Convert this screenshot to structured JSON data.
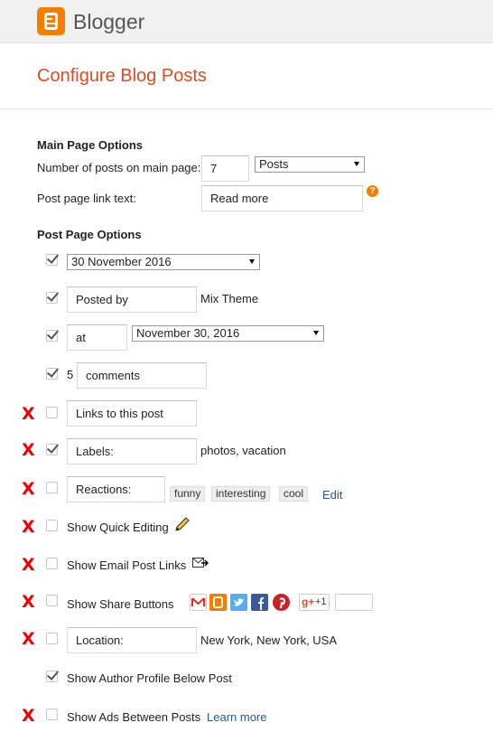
{
  "header": {
    "brand": "Blogger"
  },
  "page": {
    "title": "Configure Blog Posts"
  },
  "main_page_options": {
    "heading": "Main Page Options",
    "num_posts_label": "Number of posts on main page:",
    "num_posts_value": "7",
    "num_posts_unit": "Posts",
    "post_link_label": "Post page link text:",
    "post_link_value": "Read more",
    "help_glyph": "?"
  },
  "post_page_options": {
    "heading": "Post Page Options",
    "date_header": {
      "checked": true,
      "value": "30 November 2016"
    },
    "posted_by": {
      "checked": true,
      "value": "Posted by",
      "author": "Mix Theme"
    },
    "timestamp": {
      "checked": true,
      "value": "at",
      "format": "November 30, 2016"
    },
    "comments": {
      "checked": true,
      "count": "5",
      "value": "comments"
    },
    "links_to_post": {
      "checked": false,
      "value": "Links to this post"
    },
    "labels": {
      "checked": true,
      "value": "Labels:",
      "sample": "photos, vacation"
    },
    "reactions": {
      "checked": false,
      "value": "Reactions:",
      "tags": [
        "funny",
        "interesting",
        "cool"
      ],
      "edit_link": "Edit"
    },
    "quick_editing": {
      "checked": false,
      "label": "Show Quick Editing"
    },
    "email_links": {
      "checked": false,
      "label": "Show Email Post Links"
    },
    "share_buttons": {
      "checked": false,
      "label": "Show Share Buttons",
      "plus_one": "+1"
    },
    "location": {
      "checked": false,
      "value": "Location:",
      "sample": "New York, New York, USA"
    },
    "author_profile": {
      "checked": true,
      "label": "Show Author Profile Below Post"
    },
    "ads_between": {
      "checked": false,
      "label": "Show Ads Between Posts",
      "learn_more": "Learn more"
    }
  },
  "marker": "X",
  "colors": {
    "brand_orange": "#f57d00",
    "title_orange": "#dd4b22",
    "x_red": "#ee0000",
    "link_blue": "#1a5c9f"
  }
}
